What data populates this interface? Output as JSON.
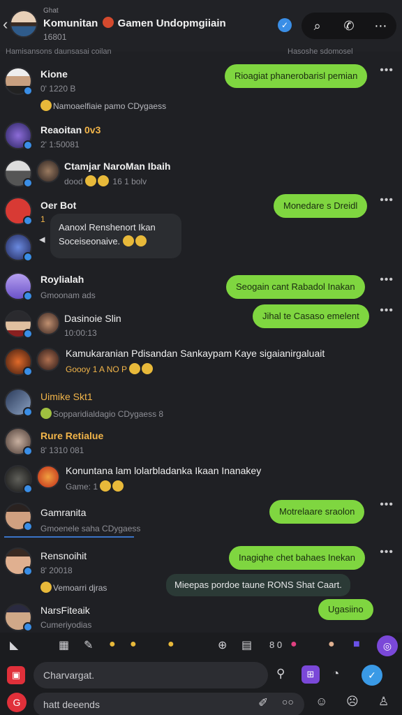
{
  "header": {
    "top_text": "Ghat",
    "title": "Komunitan",
    "title_part2": "Gamen Undopmgiiain",
    "subtitle": "16801",
    "back_icon": "chevron-left-icon",
    "actions": [
      "search-icon",
      "phone-icon",
      "more-options-icon"
    ]
  },
  "notice": {
    "left": "Hamisansons daunsasai coilan",
    "right": "Hasoshe sdomosel"
  },
  "messages": [
    {
      "name": "Kione",
      "meta": "0' 1220 B",
      "reactions": "Namoaelfiaie pamo CDygaess",
      "reply": "Rioagiat phanerobarisl pemian"
    },
    {
      "name": "Reaoitan",
      "name_extra": "0v3",
      "meta": "2' 1:50081"
    },
    {
      "name": "Ctamjar NaroMan Ibaih",
      "meta": "dood",
      "reactions": "16 1 bolv"
    },
    {
      "name": "Oer Bot",
      "meta": "1",
      "reply": "Monedare s Dreidl"
    },
    {
      "quote_line1": "Aanoxl Renshenort Ikan",
      "quote_line2": "Soceiseonaive."
    },
    {
      "name": "Roylialah",
      "meta": "Gmoonam ads",
      "reply": "Seogain cant Rabadol Inakan"
    },
    {
      "name": "Dasinoie Slin",
      "meta": "10:00:13",
      "reply": "Jihal te Casaso emelent"
    },
    {
      "name": "Kamukaranian Pdisandan Sankaypam Kaye sigaianirgaluait",
      "meta": "Goooy 1 A NO P"
    },
    {
      "name": "Uimike Skt1",
      "meta": "Sopparidialdagio CDygaess 8"
    },
    {
      "name": "Rure Retialue",
      "meta": "8' 1310 081"
    },
    {
      "name": "Konuntana lam lolarbladanka Ikaan Inanakey",
      "meta": "Game: 1"
    },
    {
      "name": "Gamranita",
      "meta": "Gmoenele saha CDygaess",
      "reply": "Motrelaare sraolon"
    },
    {
      "name": "Rensnoihit",
      "meta": "8' 20018",
      "reactions": "Vemoarri djras",
      "reply": "Inagiqhe chet bahaes Inekan",
      "reply2": "Mieepas pordoe taune RONS Shat Caart."
    },
    {
      "name": "NarsFiteaik",
      "meta": "Cumeriyodias",
      "reply": "Ugasiino"
    }
  ],
  "composer": {
    "input1": "Charvargat.",
    "input2": "hatt deeends",
    "counter": "8 0"
  },
  "colors": {
    "accent_green": "#7fd640",
    "verified_blue": "#3a8ee6",
    "background": "#1f2024"
  }
}
